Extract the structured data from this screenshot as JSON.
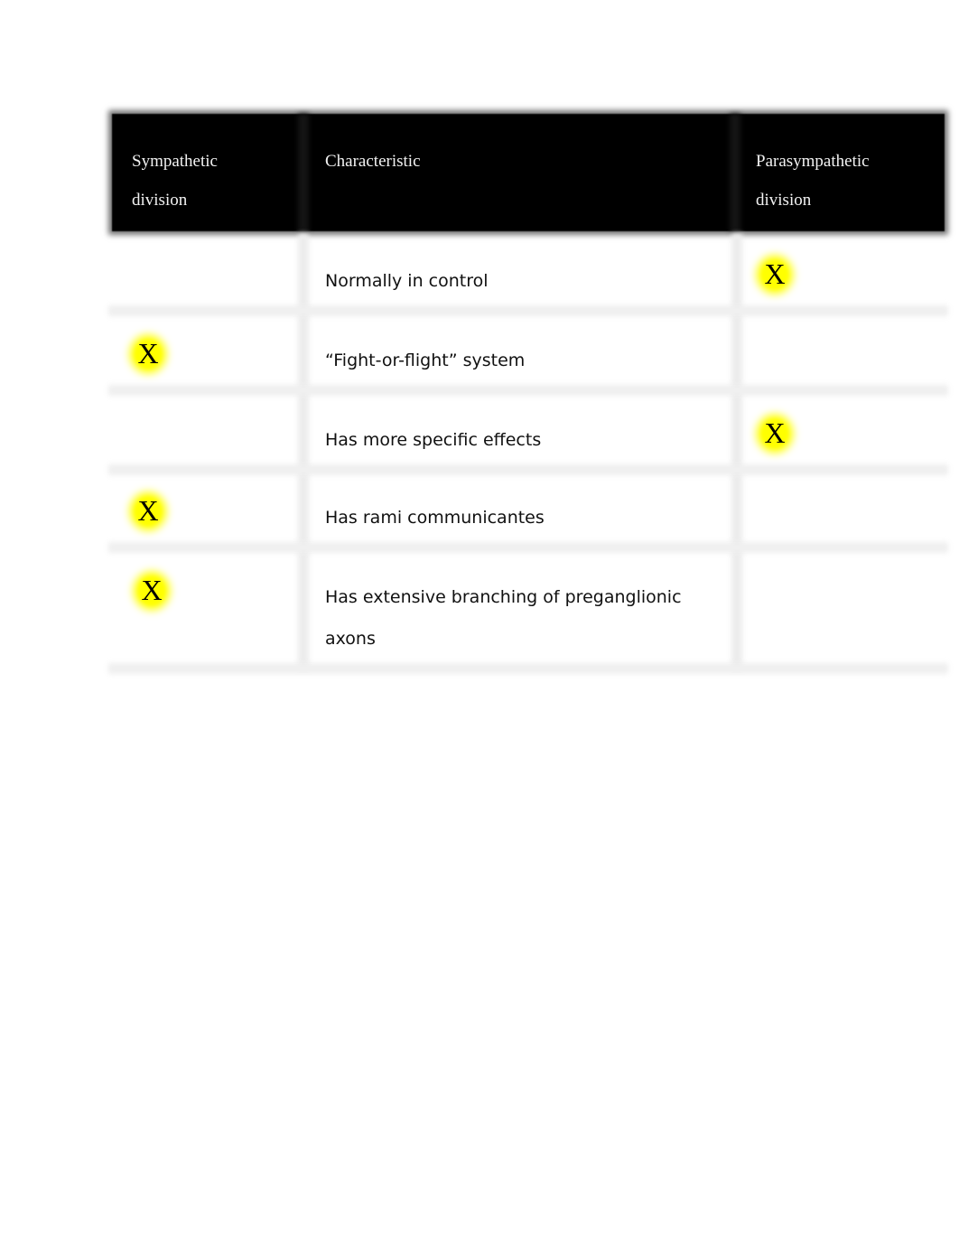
{
  "table": {
    "headers": {
      "sympathetic": "Sympathetic\ndivision",
      "characteristic": "Characteristic",
      "parasympathetic": "Parasympathetic\ndivision"
    },
    "mark_symbol": "X",
    "highlight_color": "#ffff00",
    "header_background": "#000000",
    "rows": [
      {
        "characteristic": "Normally in control",
        "sympathetic": "",
        "parasympathetic": "X"
      },
      {
        "characteristic": "“Fight-or-flight” system",
        "sympathetic": "X",
        "parasympathetic": ""
      },
      {
        "characteristic": "Has more specific effects",
        "sympathetic": "",
        "parasympathetic": "X"
      },
      {
        "characteristic": "Has rami communicantes",
        "sympathetic": "X",
        "parasympathetic": ""
      },
      {
        "characteristic": "Has extensive branching of preganglionic axons",
        "sympathetic": "X",
        "parasympathetic": ""
      }
    ]
  }
}
